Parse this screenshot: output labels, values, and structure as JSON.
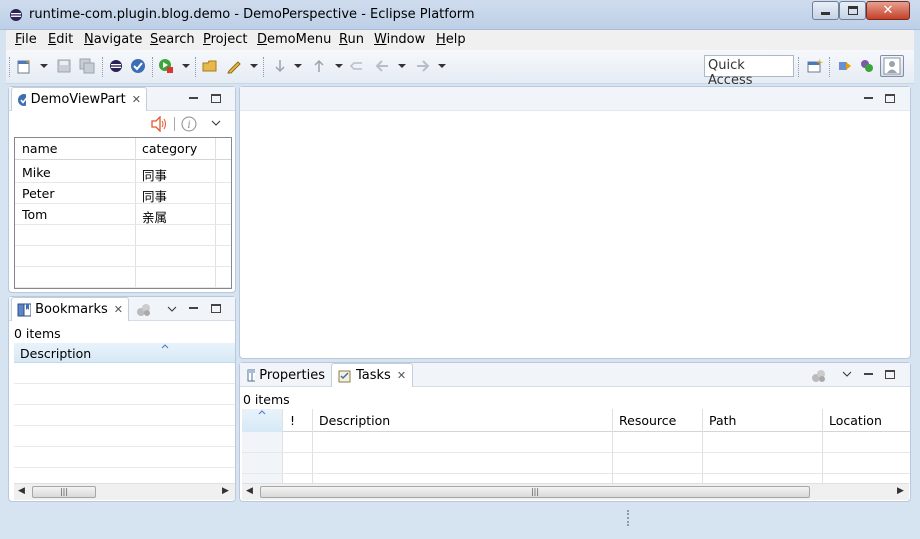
{
  "window": {
    "title": "runtime-com.plugin.blog.demo - DemoPerspective - Eclipse Platform"
  },
  "menubar": {
    "items": [
      "File",
      "Edit",
      "Navigate",
      "Search",
      "Project",
      "DemoMenu",
      "Run",
      "Window",
      "Help"
    ]
  },
  "toolbar": {
    "quick_access": "Quick Access"
  },
  "demo_view": {
    "tab_label": "DemoViewPart",
    "columns": [
      "name",
      "category"
    ],
    "rows": [
      {
        "name": "Mike",
        "category": "同事"
      },
      {
        "name": "Peter",
        "category": "同事"
      },
      {
        "name": "Tom",
        "category": "亲属"
      }
    ]
  },
  "bookmarks": {
    "tab_label": "Bookmarks",
    "count": "0 items",
    "column": "Description"
  },
  "tasks": {
    "tab_properties": "Properties",
    "tab_tasks": "Tasks",
    "count": "0 items",
    "columns": [
      "!",
      "Description",
      "Resource",
      "Path",
      "Location"
    ]
  },
  "colors": {
    "accent": "#3c6fb4",
    "close": "#c4412a",
    "speaker": "#e2572b"
  }
}
